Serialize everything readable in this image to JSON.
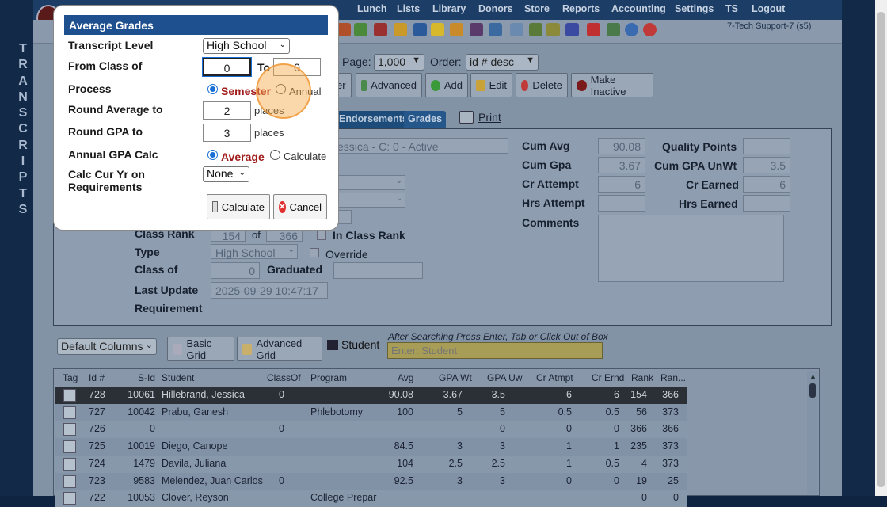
{
  "sidebar_letters": [
    "T",
    "R",
    "A",
    "N",
    "S",
    "C",
    "R",
    "I",
    "P",
    "T",
    "S"
  ],
  "menu": [
    "Lunch",
    "Lists",
    "Library",
    "Donors",
    "Store",
    "Reports",
    "Accounting",
    "Settings",
    "TS",
    "Logout"
  ],
  "user_info": "7-Tech Support-7 (s5)",
  "controls": {
    "page_label": "Page:",
    "page_value": "1,000",
    "order_label": "Order:",
    "order_value": "id # desc",
    "filter_button": "er",
    "advanced_button": "Advanced",
    "add_button": "Add",
    "edit_button": "Edit",
    "delete_button": "Delete",
    "make_inactive_button": "Make Inactive"
  },
  "tabs": [
    "Endorsements",
    "Grades"
  ],
  "print_link": "Print",
  "detail": {
    "student_value": "essica - C: 0 - Active",
    "cum_avg_label": "Cum Avg",
    "cum_avg": "90.08",
    "cum_gpa_label": "Cum Gpa",
    "cum_gpa": "3.67",
    "cr_attempt_label": "Cr Attempt",
    "cr_attempt": "6",
    "hrs_attempt_label": "Hrs Attempt",
    "hrs_attempt": "",
    "quality_points_label": "Quality Points",
    "quality_points": "",
    "cum_gpa_unwt_label": "Cum GPA UnWt",
    "cum_gpa_unwt": "3.5",
    "cr_earned_label": "Cr Earned",
    "cr_earned": "6",
    "hrs_earned_label": "Hrs Earned",
    "hrs_earned": "",
    "comments_label": "Comments",
    "class_rank_label": "Class Rank",
    "class_rank": "154",
    "of_label": "of",
    "class_size": "366",
    "in_class_rank_label": "In Class Rank",
    "type_label": "Type",
    "type_value": "High School",
    "override_label": "Override",
    "class_of_label": "Class of",
    "class_of": "0",
    "graduated_label": "Graduated",
    "last_update_label": "Last Update",
    "last_update": "2025-09-29 10:47:17",
    "requirement_label": "Requirement"
  },
  "grid_toolbar": {
    "columns_select": "Default Columns",
    "basic_grid": "Basic Grid",
    "advanced_grid": "Advanced Grid",
    "student_label": "Student",
    "search_hint": "After Searching Press Enter, Tab or Click Out of Box",
    "search_placeholder": "Enter: Student"
  },
  "grid": {
    "headers": [
      "Tag",
      "Id #",
      "S-Id",
      "Student",
      "ClassOf",
      "Program",
      "Avg",
      "GPA Wt",
      "GPA Uw",
      "Cr Atmpt",
      "Cr Ernd",
      "Rank",
      "Ran..."
    ],
    "rows": [
      {
        "id": "728",
        "sid": "10061",
        "student": "Hillebrand, Jessica",
        "classof": "0",
        "program": "",
        "avg": "90.08",
        "gpawt": "3.67",
        "gpauw": "3.5",
        "cratmpt": "6",
        "crernd": "6",
        "rank": "154",
        "ranof": "366"
      },
      {
        "id": "727",
        "sid": "10042",
        "student": "Prabu, Ganesh",
        "classof": "",
        "program": "Phlebotomy",
        "avg": "100",
        "gpawt": "5",
        "gpauw": "5",
        "cratmpt": "0.5",
        "crernd": "0.5",
        "rank": "56",
        "ranof": "373"
      },
      {
        "id": "726",
        "sid": "0",
        "student": "",
        "classof": "0",
        "program": "",
        "avg": "",
        "gpawt": "",
        "gpauw": "0",
        "cratmpt": "0",
        "crernd": "0",
        "rank": "366",
        "ranof": "366"
      },
      {
        "id": "725",
        "sid": "10019",
        "student": "Diego, Canope",
        "classof": "",
        "program": "",
        "avg": "84.5",
        "gpawt": "3",
        "gpauw": "3",
        "cratmpt": "1",
        "crernd": "1",
        "rank": "235",
        "ranof": "373"
      },
      {
        "id": "724",
        "sid": "1479",
        "student": "Davila, Juliana",
        "classof": "",
        "program": "",
        "avg": "104",
        "gpawt": "2.5",
        "gpauw": "2.5",
        "cratmpt": "1",
        "crernd": "0.5",
        "rank": "4",
        "ranof": "373"
      },
      {
        "id": "723",
        "sid": "9583",
        "student": "Melendez, Juan Carlos",
        "classof": "0",
        "program": "",
        "avg": "92.5",
        "gpawt": "3",
        "gpauw": "3",
        "cratmpt": "0",
        "crernd": "0",
        "rank": "19",
        "ranof": "25"
      },
      {
        "id": "722",
        "sid": "10053",
        "student": "Clover, Reyson",
        "classof": "",
        "program": "College Prepar",
        "avg": "",
        "gpawt": "",
        "gpauw": "",
        "cratmpt": "",
        "crernd": "",
        "rank": "0",
        "ranof": "0"
      }
    ]
  },
  "modal": {
    "title": "Average Grades",
    "transcript_level_label": "Transcript Level",
    "transcript_level": "High School",
    "from_class_label": "From Class of",
    "from_class": "0",
    "to_label": "To",
    "to_class": "0",
    "process_label": "Process",
    "semester_label": "Semester",
    "annual_label": "Annual",
    "round_avg_label": "Round Average to",
    "round_avg": "2",
    "places_label": "places",
    "round_gpa_label": "Round GPA to",
    "round_gpa": "3",
    "places_label2": "places",
    "annual_gpa_label": "Annual GPA Calc",
    "average_label": "Average",
    "calculate_label": "Calculate",
    "calc_cur_yr_label_1": "Calc Cur Yr on",
    "calc_cur_yr_label_2": "Requirements",
    "calc_cur_yr": "None",
    "calculate_button": "Calculate",
    "cancel_button": "Cancel"
  },
  "colors": {
    "modal_title_bg": "#1e4f8e",
    "semester_red": "#a11a1a",
    "highlight": "#f7a846"
  }
}
